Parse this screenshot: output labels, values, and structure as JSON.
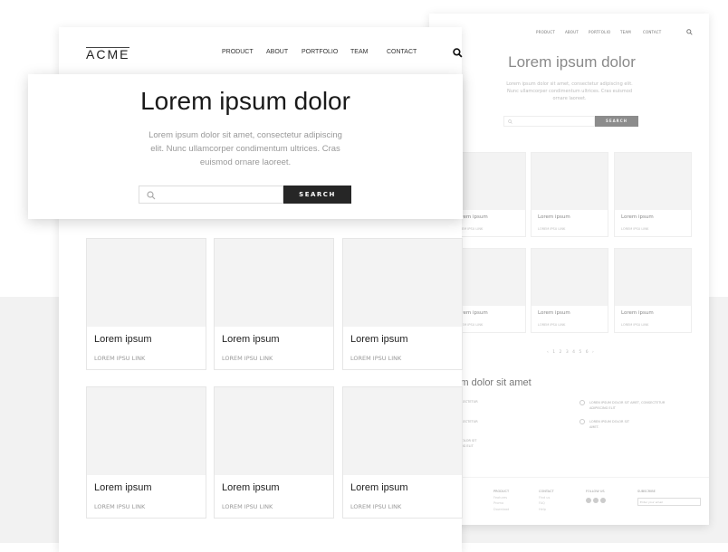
{
  "colors": {
    "accent_dark": "#262626",
    "back_button": "#8c8c8c",
    "band": "#f2f2f2"
  },
  "back_page": {
    "nav": [
      "PRODUCT",
      "ABOUT",
      "PORTFOLIO",
      "TEAM",
      "CONTACT"
    ],
    "search_icon": "search-icon",
    "title": "Lorem ipsum dolor",
    "paragraph": "Lorem ipsum dolor sit amet, consectetur adipiscing elit. Nunc ullamcorper condimentum ultrices. Cras euismod ornare laoreet.",
    "search_button": "SEARCH",
    "cards": [
      {
        "title": "Lorem ipsum",
        "link": "LOREM IPSU LINK"
      },
      {
        "title": "Lorem ipsum",
        "link": "LOREM IPSU LINK"
      },
      {
        "title": "Lorem ipsum",
        "link": "LOREM IPSU LINK"
      },
      {
        "title": "Lorem ipsum",
        "link": "LOREM IPSU LINK"
      },
      {
        "title": "Lorem ipsum",
        "link": "LOREM IPSU LINK"
      },
      {
        "title": "Lorem ipsum",
        "link": "LOREM IPSU LINK"
      }
    ],
    "pagination": "‹ 1 2 3 4 5 6 ›",
    "section_title": "Lorem ipsum dolor sit amet",
    "features_left": [
      "LOREM IPSUM DOLOR SIT AMET, CONSECTETUR",
      "LOREM IPSUM DOLOR SIT AMET, CONSECTETUR",
      "LOREM IPSUM DOLOR SIT AMET, ADIPISCING ELIT"
    ],
    "features_right": [
      "LOREN IPSUM DOLOR SIT AMET, CONSECTETUR ADIPISCING ELIT",
      "LOREN IPSUM DOLOR SIT AMET."
    ],
    "footer": {
      "product": {
        "heading": "PRODUCT",
        "items": [
          "Features",
          "Promo",
          "Download"
        ]
      },
      "contact": {
        "heading": "CONTACT",
        "items": [
          "Find us",
          "FAQ",
          "Help"
        ]
      },
      "follow": {
        "heading": "FOLLOW US"
      },
      "subscribe": {
        "heading": "SUBSCRIBE",
        "placeholder": "Enter your email"
      }
    }
  },
  "front_page": {
    "logo": "ACME",
    "nav": [
      "PRODUCT",
      "ABOUT",
      "PORTFOLIO",
      "TEAM",
      "CONTACT"
    ],
    "hero": {
      "title": "Lorem ipsum dolor",
      "paragraph": "Lorem ipsum dolor sit amet, consectetur adipiscing elit. Nunc ullamcorper condimentum ultrices. Cras euismod ornare laoreet.",
      "search_placeholder": "",
      "search_button": "SEARCH"
    },
    "cards": [
      {
        "title": "Lorem ipsum",
        "link": "LOREM IPSU LINK"
      },
      {
        "title": "Lorem ipsum",
        "link": "LOREM IPSU LINK"
      },
      {
        "title": "Lorem ipsum",
        "link": "LOREM IPSU LINK"
      },
      {
        "title": "Lorem ipsum",
        "link": "LOREM IPSU LINK"
      },
      {
        "title": "Lorem ipsum",
        "link": "LOREM IPSU LINK"
      },
      {
        "title": "Lorem ipsum",
        "link": "LOREM IPSU LINK"
      }
    ]
  }
}
